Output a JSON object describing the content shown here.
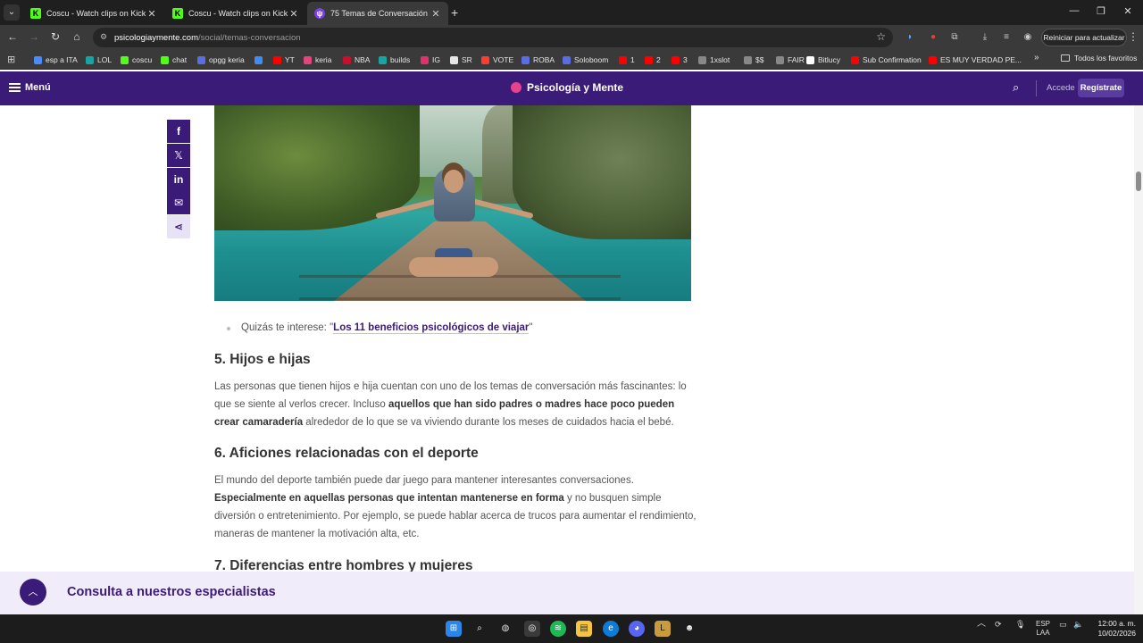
{
  "browser": {
    "tabs": [
      {
        "title": "Coscu - Watch clips on Kick",
        "favicon": "kick-icon"
      },
      {
        "title": "Coscu - Watch clips on Kick",
        "favicon": "kick-icon"
      },
      {
        "title": "75 Temas de Conversación intere",
        "favicon": "psicologia-icon"
      }
    ],
    "url_site": "psicologiaymente.com",
    "url_path": "/social/temas-conversacion",
    "restart_label": "Reiniciar para actualizar",
    "bookmarks": [
      {
        "label": "esp a ITA",
        "color": "#4c8bf5"
      },
      {
        "label": "LOL",
        "color": "#1aa3a3"
      },
      {
        "label": "coscu",
        "color": "#53fc18"
      },
      {
        "label": "chat",
        "color": "#53fc18"
      },
      {
        "label": "opgg keria",
        "color": "#5b6de0"
      },
      {
        "label": "",
        "color": "#3d8ef0"
      },
      {
        "label": "YT",
        "color": "#ff0000"
      },
      {
        "label": "keria",
        "color": "#e0457b"
      },
      {
        "label": "NBA",
        "color": "#c8102e"
      },
      {
        "label": "builds",
        "color": "#1aa3a3"
      },
      {
        "label": "IG",
        "color": "#e1306c"
      },
      {
        "label": "SR",
        "color": "#e6e6e6"
      },
      {
        "label": "VOTE",
        "color": "#ff3b30"
      },
      {
        "label": "ROBA",
        "color": "#5b6de0"
      },
      {
        "label": "Soloboom",
        "color": "#5b6de0"
      },
      {
        "label": "1",
        "color": "#ff0000"
      },
      {
        "label": "2",
        "color": "#ff0000"
      },
      {
        "label": "3",
        "color": "#ff0000"
      },
      {
        "label": "1xslot",
        "color": "#888888"
      },
      {
        "label": "$$",
        "color": "#888888"
      },
      {
        "label": "FAIR",
        "color": "#888888"
      },
      {
        "label": "Bitlucy",
        "color": "#ffffff"
      },
      {
        "label": "Sub Confirmation",
        "color": "#ff0000"
      },
      {
        "label": "ES MUY VERDAD PE...",
        "color": "#ff0000"
      }
    ],
    "all_bookmarks": "Todos los favoritos"
  },
  "site": {
    "menu_label": "Menú",
    "brand": "Psicología y Mente",
    "login": "Accede",
    "signup": "Regístrate"
  },
  "article": {
    "tip_prefix": "Quizás te interese: \"",
    "tip_link": "Los 11 beneficios psicológicos de viajar",
    "tip_suffix": "\"",
    "s5_title": "5. Hijos e hijas",
    "s5_p1": "Las personas que tienen hijos e hija cuentan con uno de los temas de conversación más fascinantes: lo que se siente al verlos crecer. Incluso ",
    "s5_b": "aquellos que han sido padres o madres hace poco pueden crear camaradería",
    "s5_p2": " alrededor de lo que se va viviendo durante los meses de cuidados hacia el bebé.",
    "s6_title": "6. Aficiones relacionadas con el deporte",
    "s6_p1": "El mundo del deporte también puede dar juego para mantener interesantes conversaciones. ",
    "s6_b": "Especialmente en aquellas personas que intentan mantenerse en forma",
    "s6_p2": " y no busquen simple diversión o entretenimiento. Por ejemplo, se puede hablar acerca de trucos para aumentar el rendimiento, maneras de mantener la motivación alta, etc.",
    "s7_title": "7. Diferencias entre hombres y mujeres"
  },
  "banner": {
    "text": "Consulta a nuestros especialistas"
  },
  "taskbar": {
    "lang_1": "ESP",
    "lang_2": "LAA",
    "time": "12:00 a. m.",
    "date": "10/02/2026"
  }
}
